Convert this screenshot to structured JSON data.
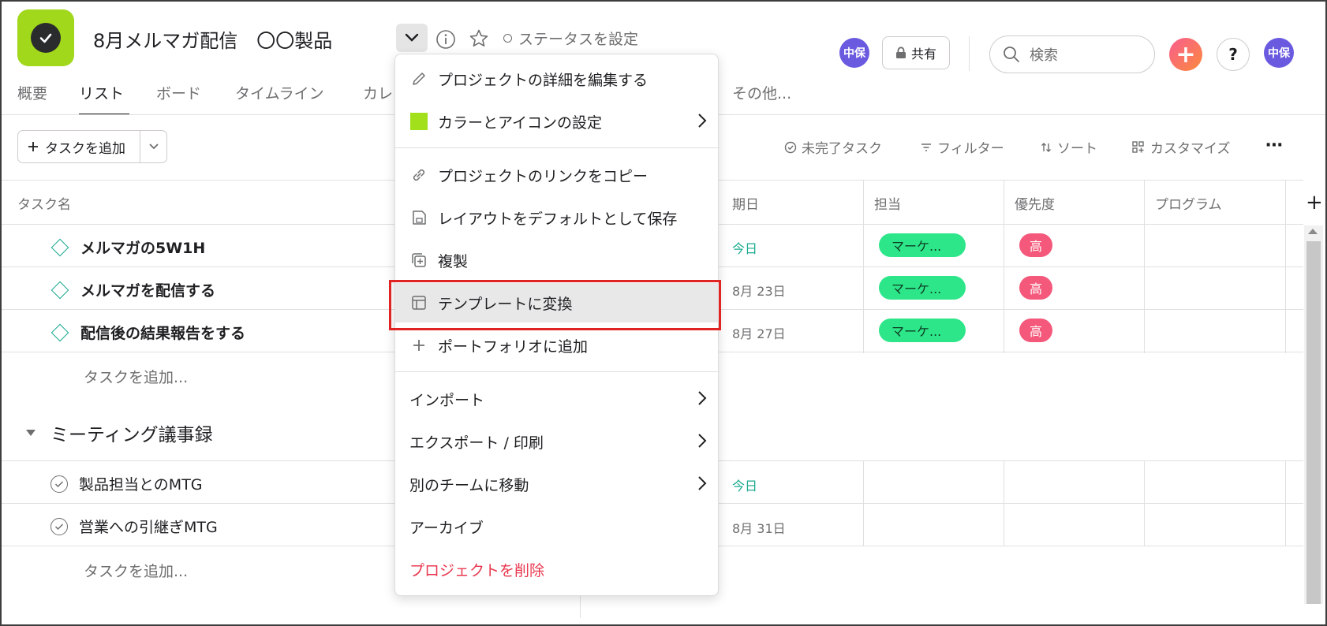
{
  "header": {
    "title": "8月メルマガ配信　〇〇製品",
    "status": "ステータスを設定",
    "share_label": "共有",
    "search_placeholder": "検索",
    "avatar_initials": "中保",
    "help_label": "?",
    "plus_label": "+"
  },
  "tabs": [
    {
      "label": "概要"
    },
    {
      "label": "リスト"
    },
    {
      "label": "ボード"
    },
    {
      "label": "タイムライン"
    },
    {
      "label": "カレ"
    },
    {
      "label": "その他..."
    }
  ],
  "toolbar": {
    "add_task": "タスクを追加",
    "incomplete": "未完了タスク",
    "filter": "フィルター",
    "sort": "ソート",
    "customize": "カスタマイズ",
    "more": "⋯"
  },
  "table": {
    "columns": [
      "タスク名",
      "期日",
      "担当",
      "優先度",
      "プログラム"
    ],
    "tasks": [
      {
        "name": "メルマガの5W1H",
        "date": "今日",
        "assignee": "マーケ...",
        "priority": "高"
      },
      {
        "name": "メルマガを配信する",
        "date": "8月 23日",
        "assignee": "マーケ...",
        "priority": "高"
      },
      {
        "name": "配信後の結果報告をする",
        "date": "8月 27日",
        "assignee": "マーケ...",
        "priority": "高"
      }
    ],
    "add_task_link": "タスクを追加...",
    "section": {
      "name": "ミーティング議事録",
      "tasks": [
        {
          "name": "製品担当とのMTG",
          "date": "今日"
        },
        {
          "name": "営業への引継ぎMTG",
          "date": "8月 31日"
        }
      ],
      "add_task_link": "タスクを追加..."
    }
  },
  "menu": {
    "items": [
      {
        "label": "プロジェクトの詳細を編集する"
      },
      {
        "label": "カラーとアイコンの設定"
      },
      {
        "label": "プロジェクトのリンクをコピー"
      },
      {
        "label": "レイアウトをデフォルトとして保存"
      },
      {
        "label": "複製"
      },
      {
        "label": "テンプレートに変換"
      },
      {
        "label": "ポートフォリオに追加"
      },
      {
        "label": "インポート"
      },
      {
        "label": "エクスポート / 印刷"
      },
      {
        "label": "別のチームに移動"
      },
      {
        "label": "アーカイブ"
      },
      {
        "label": "プロジェクトを削除"
      }
    ]
  },
  "colors": {
    "project_icon": "#a1d81b",
    "accent_green": "#2ee68a",
    "priority_high": "#f4587a",
    "danger": "#e8384f",
    "highlight_box": "#e02424",
    "today": "#1aaa8f"
  }
}
